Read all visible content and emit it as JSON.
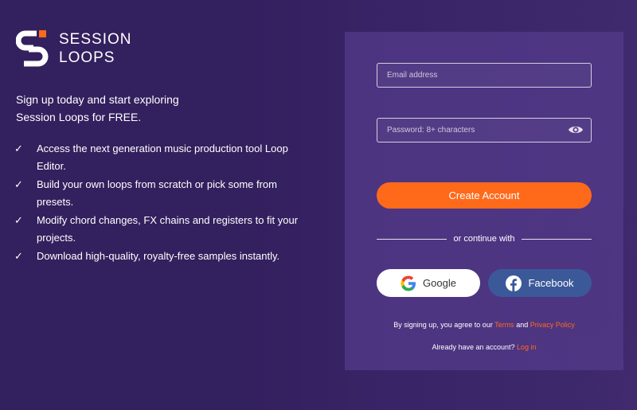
{
  "brand": {
    "line1": "SESSION",
    "line2": "LOOPS",
    "accent": "#ff6a1a"
  },
  "intro": {
    "line1": "Sign up today and start exploring",
    "line2": "Session Loops for FREE."
  },
  "features": [
    "Access the next generation music production tool Loop Editor.",
    "Build your own loops from scratch or pick some from presets.",
    "Modify chord changes, FX chains and registers to fit your projects.",
    "Download high-quality, royalty-free samples instantly."
  ],
  "form": {
    "email_placeholder": "Email address",
    "email_value": "",
    "password_placeholder": "Password: 8+ characters",
    "password_value": "",
    "password_icon": "eye-icon",
    "create_label": "Create Account",
    "divider_text": "or continue with",
    "google_label": "Google",
    "facebook_label": "Facebook",
    "terms_prefix": "By signing up, you agree to our",
    "terms_link": "Terms",
    "terms_and": "and",
    "privacy_link": "Privacy Policy",
    "login_prefix": "Already have an account?",
    "login_link": "Log in"
  },
  "colors": {
    "background": "#33205e",
    "panel": "#55398c",
    "primary": "#ff6a1a",
    "facebook": "#3b5998"
  }
}
